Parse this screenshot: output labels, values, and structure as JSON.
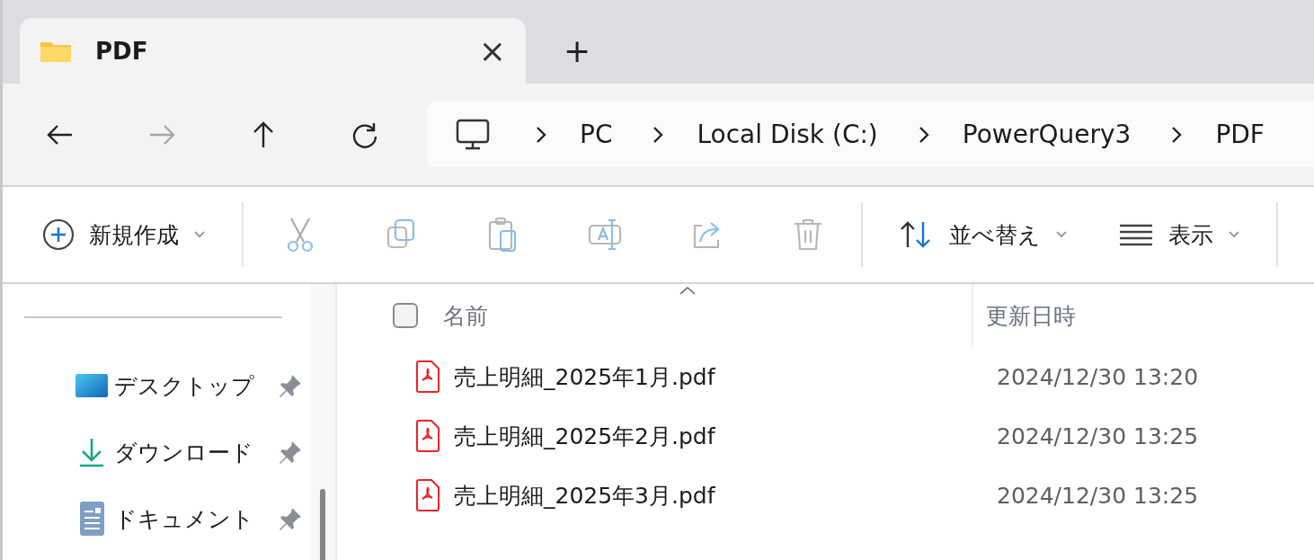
{
  "tab": {
    "title": "PDF",
    "close": "×",
    "new_tab": "+"
  },
  "nav": [
    {
      "kind": "back",
      "disabled": false
    },
    {
      "kind": "forward",
      "disabled": true
    },
    {
      "kind": "up",
      "disabled": false
    },
    {
      "kind": "refresh",
      "disabled": false
    }
  ],
  "breadcrumb": [
    "PC",
    "Local Disk (C:)",
    "PowerQuery3",
    "PDF"
  ],
  "toolbar": {
    "new_label": "新規作成",
    "actions": [
      {
        "kind": "cut",
        "disabled": true
      },
      {
        "kind": "copy",
        "disabled": true
      },
      {
        "kind": "paste",
        "disabled": true
      },
      {
        "kind": "rename",
        "disabled": true
      },
      {
        "kind": "share",
        "disabled": true
      },
      {
        "kind": "delete",
        "disabled": true
      }
    ],
    "sort_label": "並べ替え",
    "view_label": "表示"
  },
  "sidebar": {
    "items": [
      {
        "kind": "desktop",
        "label": "デスクトップ",
        "pinned": true
      },
      {
        "kind": "downloads",
        "label": "ダウンロード",
        "pinned": true
      },
      {
        "kind": "documents",
        "label": "ドキュメント",
        "pinned": true
      }
    ]
  },
  "table": {
    "select_all": {
      "checked": false
    },
    "columns": [
      "名前",
      "更新日時"
    ],
    "rows": [
      {
        "name": "売上明細_2025年1月.pdf",
        "modified": "2024/12/30 13:20"
      },
      {
        "name": "売上明細_2025年2月.pdf",
        "modified": "2024/12/30 13:25"
      },
      {
        "name": "売上明細_2025年3月.pdf",
        "modified": "2024/12/30 13:25"
      }
    ]
  }
}
